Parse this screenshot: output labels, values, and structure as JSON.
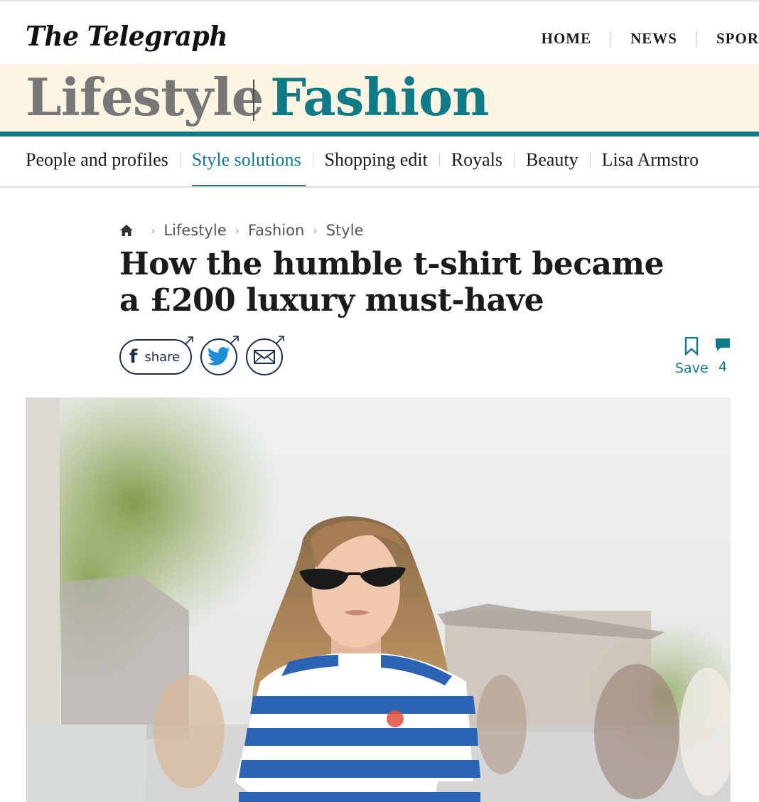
{
  "masthead": {
    "logo": "The Telegraph",
    "nav": [
      "HOME",
      "NEWS",
      "SPOR"
    ]
  },
  "section": {
    "parent": "Lifestyle",
    "name": "Fashion"
  },
  "subnav": {
    "items": [
      "People and profiles",
      "Style solutions",
      "Shopping edit",
      "Royals",
      "Beauty",
      "Lisa Armstro"
    ],
    "active_index": 1
  },
  "breadcrumb": [
    "Lifestyle",
    "Fashion",
    "Style"
  ],
  "article": {
    "headline": "How the humble t-shirt became a £200 luxury must-have"
  },
  "share": {
    "facebook_label": "share",
    "facebook_glyph": "f",
    "icons": [
      "facebook-icon",
      "twitter-icon",
      "email-icon"
    ]
  },
  "actions": {
    "save_label": "Save",
    "comment_count": "4"
  },
  "colors": {
    "accent": "#107b87",
    "banner_bg": "#fdf4e3",
    "text": "#1b1b1b",
    "share_ink": "#1d2d4a"
  }
}
